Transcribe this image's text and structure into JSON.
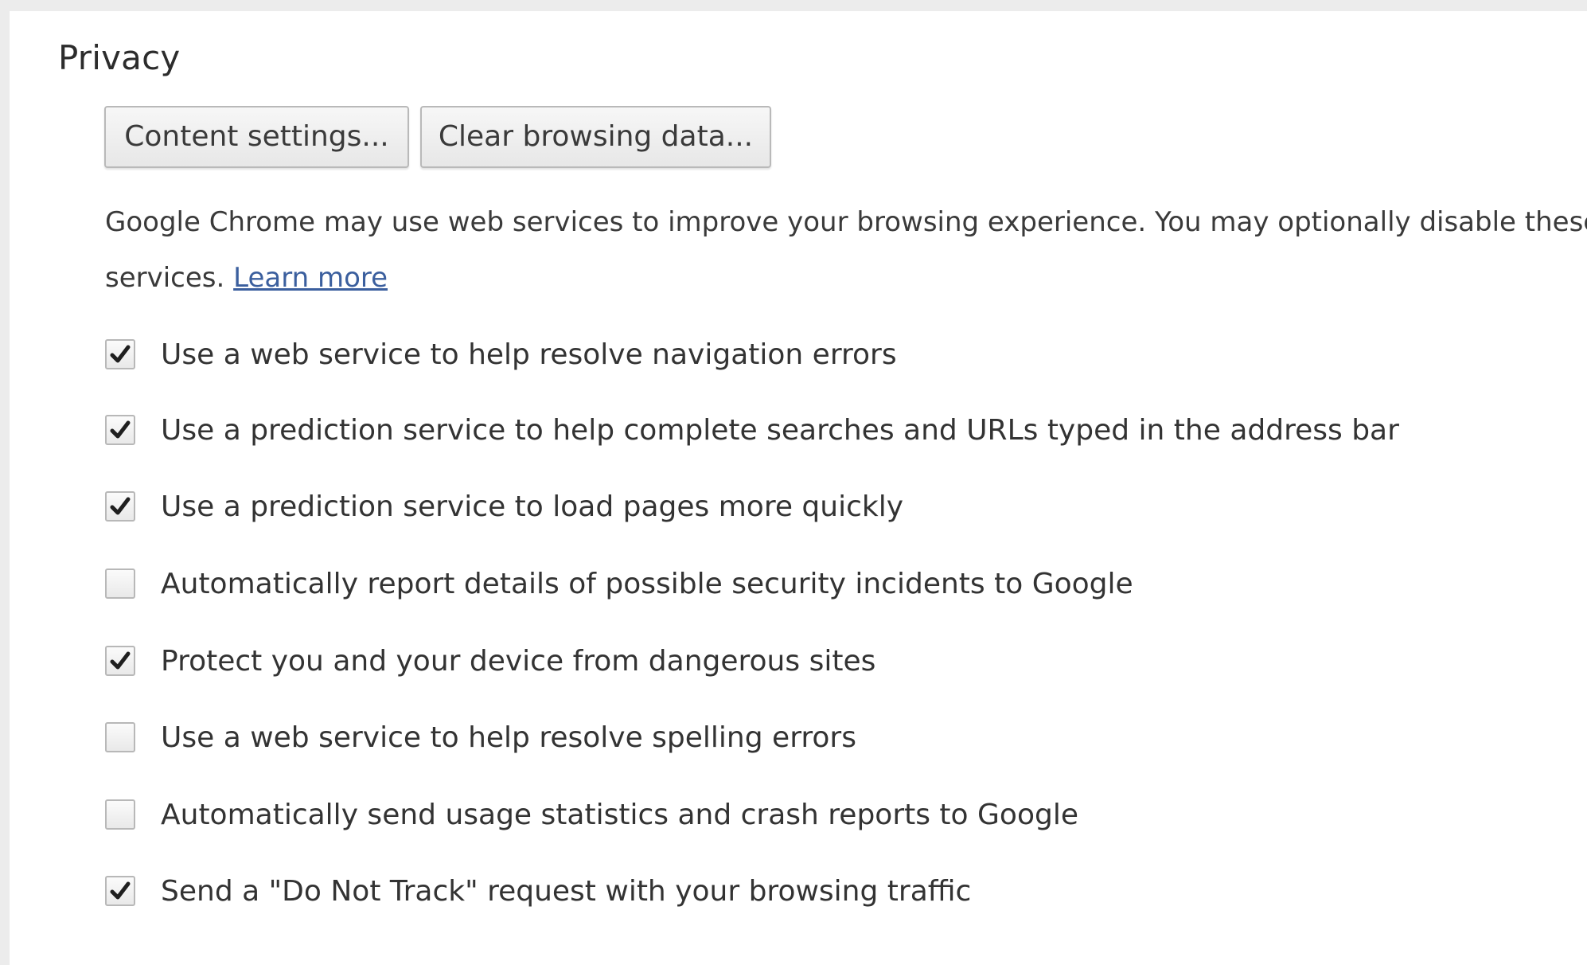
{
  "privacy": {
    "title": "Privacy",
    "buttons": {
      "content_settings": "Content settings...",
      "clear_browsing_data": "Clear browsing data..."
    },
    "description_line1": "Google Chrome may use web services to improve your browsing experience. You may optionally disable these",
    "description_line2": "services.",
    "learn_more": "Learn more",
    "options": [
      {
        "label": "Use a web service to help resolve navigation errors",
        "checked": true
      },
      {
        "label": "Use a prediction service to help complete searches and URLs typed in the address bar",
        "checked": true
      },
      {
        "label": "Use a prediction service to load pages more quickly",
        "checked": true
      },
      {
        "label": "Automatically report details of possible security incidents to Google",
        "checked": false
      },
      {
        "label": "Protect you and your device from dangerous sites",
        "checked": true
      },
      {
        "label": "Use a web service to help resolve spelling errors",
        "checked": false
      },
      {
        "label": "Automatically send usage statistics and crash reports to Google",
        "checked": false
      },
      {
        "label": "Send a \"Do Not Track\" request with your browsing traffic",
        "checked": true
      }
    ]
  },
  "colors": {
    "link": "#3b5f9e",
    "text": "#333333",
    "checkmark": "#1f1f1f"
  },
  "icons": {
    "checked": "checkmark-icon"
  }
}
